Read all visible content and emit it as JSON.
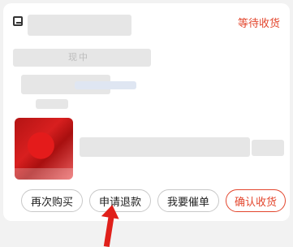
{
  "order": {
    "status": "等待收货",
    "shop_name_obscured": "",
    "info_line_obscured": "现中",
    "product_title_obscured": ""
  },
  "actions": {
    "buy_again": "再次购买",
    "request_refund": "申请退款",
    "urge_order": "我要催单",
    "confirm_receipt": "确认收货"
  },
  "colors": {
    "accent": "#e3462d",
    "annotation_arrow": "#e0201b"
  }
}
